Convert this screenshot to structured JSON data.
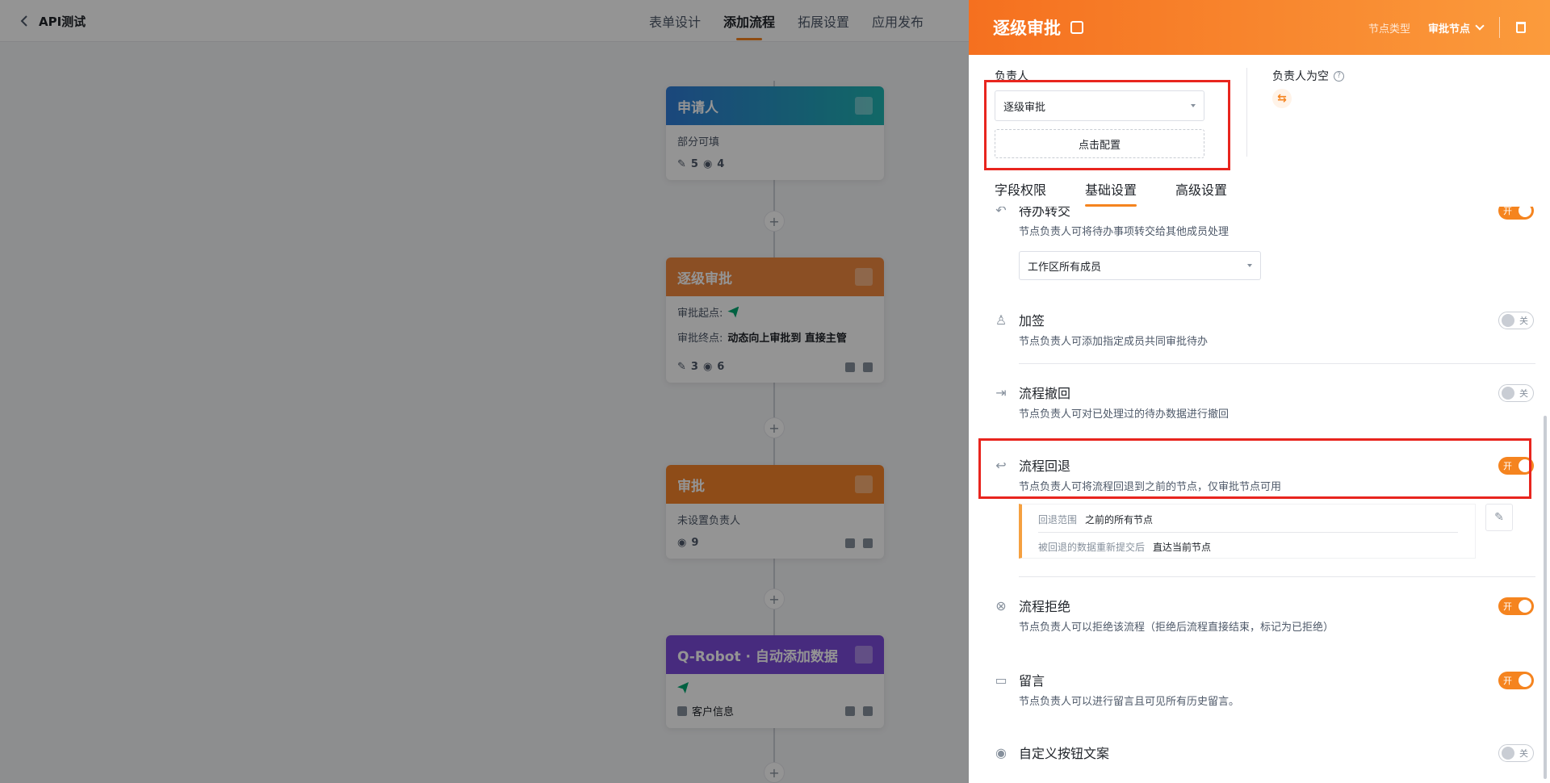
{
  "app": {
    "title": "API测试",
    "tabs": [
      "表单设计",
      "添加流程",
      "拓展设置",
      "应用发布"
    ],
    "active_tab": 1
  },
  "flow": {
    "nodes": [
      {
        "title": "申请人",
        "color": "#2f7bd6",
        "rows": [
          "部分可填"
        ],
        "edit_count": "5",
        "view_count": "4"
      },
      {
        "title": "逐级审批",
        "color": "#f0883e",
        "start_label": "审批起点:",
        "end_label": "审批终点:",
        "end_value": "动态向上审批到 直接主管",
        "edit_count": "3",
        "view_count": "6"
      },
      {
        "title": "审批",
        "color": "#f5842a",
        "rows": [
          "未设置负责人"
        ],
        "view_count": "9"
      },
      {
        "title": "Q-Robot · 自动添加数据",
        "color": "#7b4bd9",
        "rows": [
          "客户信息"
        ]
      }
    ],
    "plus_symbol": "+"
  },
  "panel": {
    "title": "逐级审批",
    "node_type_label": "节点类型",
    "node_type_value": "审批节点",
    "owner_label": "负责人",
    "owner_select": "逐级审批",
    "config_button": "点击配置",
    "empty_owner_label": "负责人为空",
    "help_symbol": "?",
    "swap_symbol": "⇆",
    "sub_tabs": [
      "字段权限",
      "基础设置",
      "高级设置"
    ],
    "active_sub_tab": 1,
    "settings": {
      "transfer": {
        "title": "待办转交",
        "desc": "节点负责人可将待办事项转交给其他成员处理",
        "toggle": "开",
        "select": "工作区所有成员"
      },
      "countersign": {
        "title": "加签",
        "desc": "节点负责人可添加指定成员共同审批待办",
        "toggle": "关"
      },
      "withdraw": {
        "title": "流程撤回",
        "desc": "节点负责人可对已处理过的待办数据进行撤回",
        "toggle": "关"
      },
      "rollback": {
        "title": "流程回退",
        "desc": "节点负责人可将流程回退到之前的节点，仅审批节点可用",
        "toggle": "开",
        "range_label": "回退范围",
        "range_value": "之前的所有节点",
        "resubmit_label": "被回退的数据重新提交后",
        "resubmit_value": "直达当前节点"
      },
      "reject": {
        "title": "流程拒绝",
        "desc": "节点负责人可以拒绝该流程（拒绝后流程直接结束，标记为已拒绝）",
        "toggle": "开"
      },
      "comment": {
        "title": "留言",
        "desc": "节点负责人可以进行留言且可见所有历史留言。",
        "toggle": "开"
      },
      "custom_button": {
        "title": "自定义按钮文案",
        "toggle": "关"
      }
    }
  }
}
